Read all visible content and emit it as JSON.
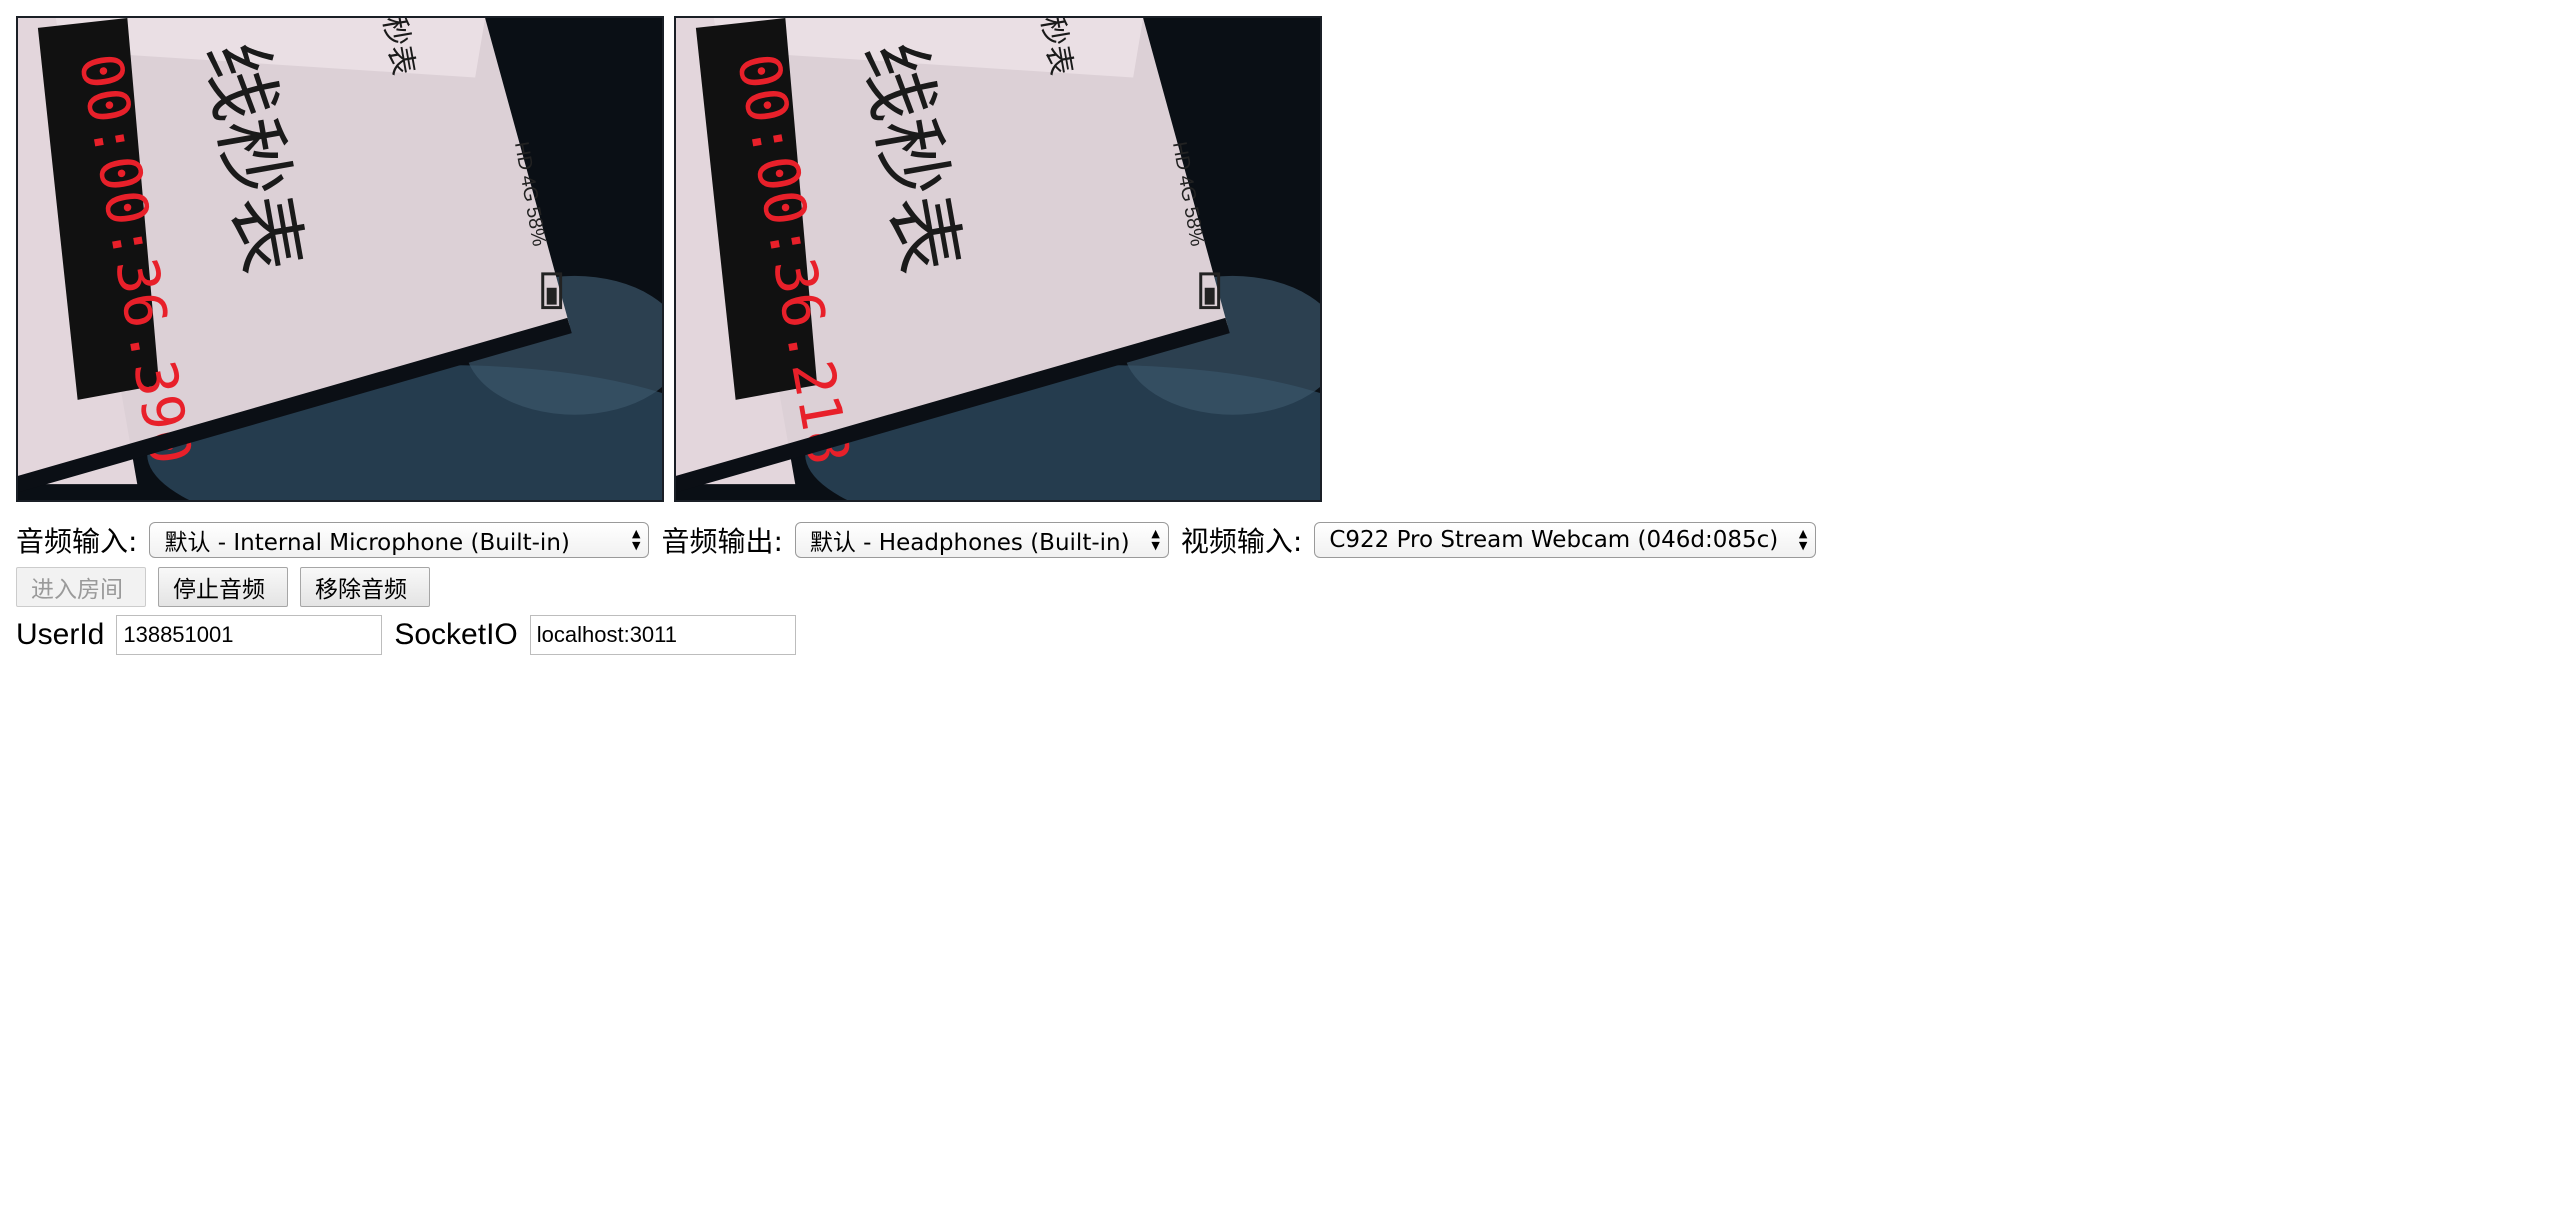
{
  "videos": {
    "local": {
      "timer_text": "00:00:36.390",
      "screen_title": "线秒表",
      "screen_corner": "秒表",
      "status_text": "HD 4G 58%"
    },
    "remote": {
      "timer_text": "00:00:36.218",
      "screen_title": "线秒表",
      "screen_corner": "秒表",
      "status_text": "HD 4G 58%"
    }
  },
  "devices": {
    "audio_input_label": "音频输入:",
    "audio_input_value": "默认 - Internal Microphone (Built-in)",
    "audio_output_label": "音频输出:",
    "audio_output_value": "默认 - Headphones (Built-in)",
    "video_input_label": "视频输入:",
    "video_input_value": "C922 Pro Stream Webcam (046d:085c)"
  },
  "buttons": {
    "join_room": "进入房间",
    "stop_audio": "停止音频",
    "remove_audio": "移除音频"
  },
  "fields": {
    "userid_label": "UserId",
    "userid_value": "138851001",
    "socketio_label": "SocketIO",
    "socketio_value": "localhost:3011"
  },
  "colors": {
    "timer_red": "#e8202a",
    "screen_paper": "#e9dde2"
  }
}
